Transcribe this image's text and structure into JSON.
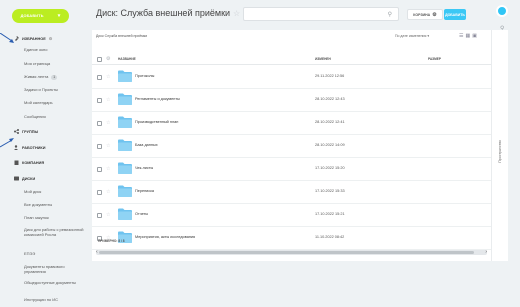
{
  "sidebar": {
    "add_button": "ДОБАВИТЬ",
    "sections": {
      "favorites": "ИЗБРАННОЕ",
      "groups": "ГРУППЫ",
      "employees": "РАБОТНИКИ",
      "company": "КОМПАНИЯ",
      "disks": "ДИСКИ"
    },
    "favorites_items": [
      "Единое окно",
      "Моя страница",
      "Живая лента",
      "Задачи и Проекты",
      "Мой календарь",
      "Сообщения"
    ],
    "live_feed_count": "1",
    "disk_items": [
      "Мой диск",
      "Все документы",
      "План закупок",
      "Диск для работы с ревизионной комиссией Росла",
      "ЕПЭЭ",
      "Документы правового управления",
      "Общедоступные документы",
      "Инструкции по ИС"
    ]
  },
  "header": {
    "title": "Диск: Служба внешней приёмки",
    "korzina": "КОРЗИНА",
    "add": "ДОБАВИТЬ"
  },
  "panel": {
    "breadcrumb": "Диск Служба внешней приёмки",
    "sort": "По дате изменения",
    "columns": {
      "name": "НАЗВАНИЕ",
      "modified": "ИЗМЕНЕН",
      "size": "РАЗМЕР"
    },
    "rows": [
      {
        "name": "Протоколы",
        "date": "29.11.2022 12:56"
      },
      {
        "name": "Регламенты и документы",
        "date": "28.10.2022 12:43"
      },
      {
        "name": "Производственный план",
        "date": "28.10.2022 12:41"
      },
      {
        "name": "База данных",
        "date": "28.10.2022 14:09"
      },
      {
        "name": "Чек-листы",
        "date": "17.10.2022 15:20"
      },
      {
        "name": "Переписка",
        "date": "17.10.2022 15:33"
      },
      {
        "name": "Отчеты",
        "date": "17.10.2022 15:21"
      },
      {
        "name": "Мероприятия, акты исследования",
        "date": "11.10.2022 08:42"
      }
    ],
    "total": "ПРИМЕРНО: 8 / 8",
    "side_label": "Пространство"
  },
  "colors": {
    "accent_green": "#bbed21",
    "accent_blue": "#3bc8f5",
    "folder": "#6fc3ef"
  }
}
